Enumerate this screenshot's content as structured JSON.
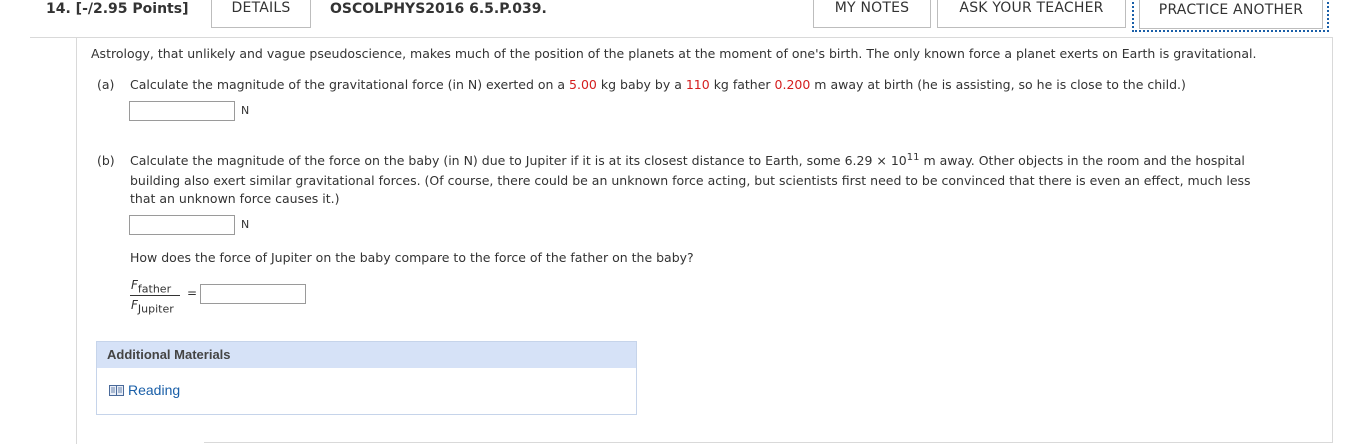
{
  "header": {
    "question_number": "14. [-/2.95 Points]",
    "details_label": "DETAILS",
    "problem_code": "OSCOLPHYS2016 6.5.P.039.",
    "my_notes_label": "MY NOTES",
    "ask_teacher_label": "ASK YOUR TEACHER",
    "practice_another_label": "PRACTICE ANOTHER"
  },
  "problem": {
    "intro": "Astrology, that unlikely and vague pseudoscience, makes much of the position of the planets at the moment of one's birth. The only known force a planet exerts on Earth is gravitational.",
    "part_a": {
      "label": "(a)",
      "text_1": "Calculate the magnitude of the gravitational force (in N) exerted on a ",
      "baby_mass": "5.00",
      "text_2": " kg baby by a ",
      "father_mass": "110",
      "text_3": " kg father ",
      "distance": "0.200",
      "text_4": " m away at birth (he is assisting, so he is close to the child.)",
      "answer_value": "",
      "unit": "N"
    },
    "part_b": {
      "label": "(b)",
      "line_1a": "Calculate the magnitude of the force on the baby (in N) due to Jupiter if it is at its closest distance to Earth, some 6.29 × 10",
      "exponent": "11",
      "line_1b": " m away. Other objects in the room and the hospital",
      "line_2": "building also exert similar gravitational forces. (Of course, there could be an unknown force acting, but scientists first need to be convinced that there is even an effect, much less",
      "line_3": "that an unknown force causes it.)",
      "answer_value": "",
      "unit": "N",
      "compare_question": "How does the force of Jupiter on the baby compare to the force of the father on the baby?",
      "ratio_num_symbol": "F",
      "ratio_num_sub": "father",
      "ratio_den_symbol": "F",
      "ratio_den_sub": "Jupiter",
      "equals": "=",
      "ratio_answer_value": ""
    }
  },
  "additional_materials": {
    "heading": "Additional Materials",
    "link_label": "Reading",
    "link_icon": "book-icon"
  }
}
